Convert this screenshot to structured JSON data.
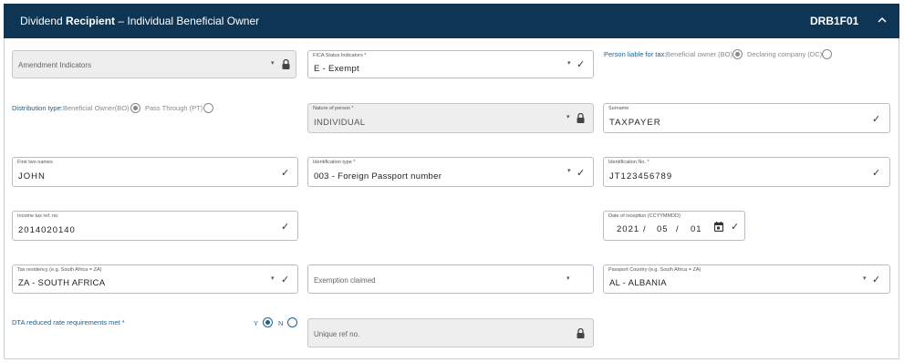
{
  "header": {
    "title_prefix": "Dividend ",
    "title_bold": "Recipient",
    "title_suffix": " – Individual Beneficial Owner",
    "code": "DRB1F01"
  },
  "row1": {
    "amendment": {
      "placeholder": "Amendment Indicators"
    },
    "fica": {
      "label": "FICA Status Indicators *",
      "value": "E - Exempt"
    },
    "person_liable": {
      "label": "Person liable for tax:",
      "option1": "Beneficial owner (BO)",
      "option2": "Declaring company (DC)",
      "selected": "BO"
    }
  },
  "row2": {
    "distribution": {
      "label": "Distribution type:",
      "option1": "Beneficial Owner(BO)",
      "option2": "Pass Through (PT)",
      "selected": "BO"
    },
    "nature": {
      "label": "Nature of person *",
      "value": "INDIVIDUAL"
    },
    "surname": {
      "label": "Surname",
      "value": "TAXPAYER"
    }
  },
  "row3": {
    "first_names": {
      "label": "First two names",
      "value": "JOHN"
    },
    "id_type": {
      "label": "Identification type *",
      "value": "003 - Foreign Passport number"
    },
    "id_no": {
      "label": "Identification No. *",
      "value": "JT123456789"
    }
  },
  "row4": {
    "income_tax": {
      "label": "Income tax ref. no.",
      "value": "2014020140"
    },
    "inception": {
      "label": "Date of inception (CCYYMMDD)",
      "year": "2021",
      "month": "05",
      "day": "01",
      "sep": "/"
    }
  },
  "row5": {
    "tax_residency": {
      "label": "Tax residency (e.g. South Africa = ZA)",
      "value": "ZA - SOUTH AFRICA"
    },
    "exemption": {
      "placeholder": "Exemption claimed"
    },
    "passport_country": {
      "label": "Passport Country (e.g. South Africa = ZA)",
      "value": "AL - ALBANIA"
    }
  },
  "row6": {
    "dta": {
      "label": "DTA reduced rate requirements met *",
      "yes": "Y",
      "no": "N",
      "selected": "Y"
    },
    "unique_ref": {
      "placeholder": "Unique ref no."
    }
  },
  "icons": {
    "dropdown": "▾",
    "check": "✓",
    "caret_up": "︿",
    "calendar": "calendar-icon",
    "lock": "lock-icon"
  },
  "colors": {
    "header_bg": "#0f3555",
    "accent": "#1f5f8b"
  }
}
